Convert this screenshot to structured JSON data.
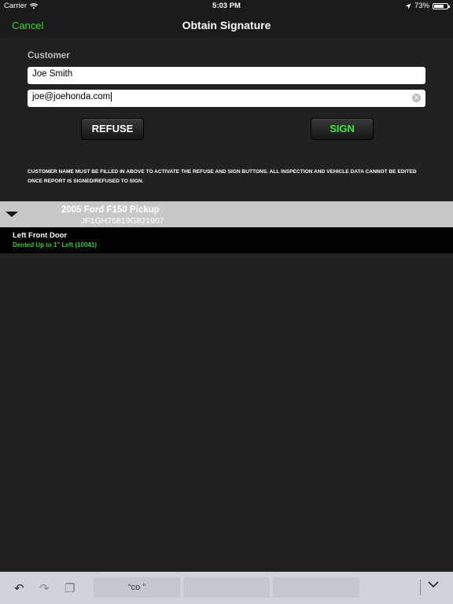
{
  "status_bar": {
    "carrier": "Carrier",
    "time": "5:03 PM",
    "battery": "73%",
    "battery_level": 0.73
  },
  "nav": {
    "cancel_label": "Cancel",
    "title": "Obtain Signature"
  },
  "form": {
    "customer_label": "Customer",
    "name_value": "Joe Smith",
    "email_value": "joe@joehonda.com",
    "refuse_label": "REFUSE",
    "sign_label": "SIGN",
    "notice": "CUSTOMER NAME MUST BE FILLED IN ABOVE TO ACTIVATE THE REFUSE AND SIGN BUTTONS.  ALL INSPECTION AND VEHICLE DATA CANNOT BE EDITED ONCE REPORT IS SIGNED/REFUSED TO SIGN."
  },
  "vehicle": {
    "title": "2005 Ford F150 Pickup",
    "vin": "JF1GH76819G821907"
  },
  "damage": {
    "title": "Left Front Door",
    "description": "Dented Up to 1\" Left (10041)"
  },
  "keyboard": {
    "suggestions": [
      "“co ”",
      "",
      ""
    ]
  },
  "colors": {
    "accent_green": "#33d633",
    "background": "#212121"
  }
}
